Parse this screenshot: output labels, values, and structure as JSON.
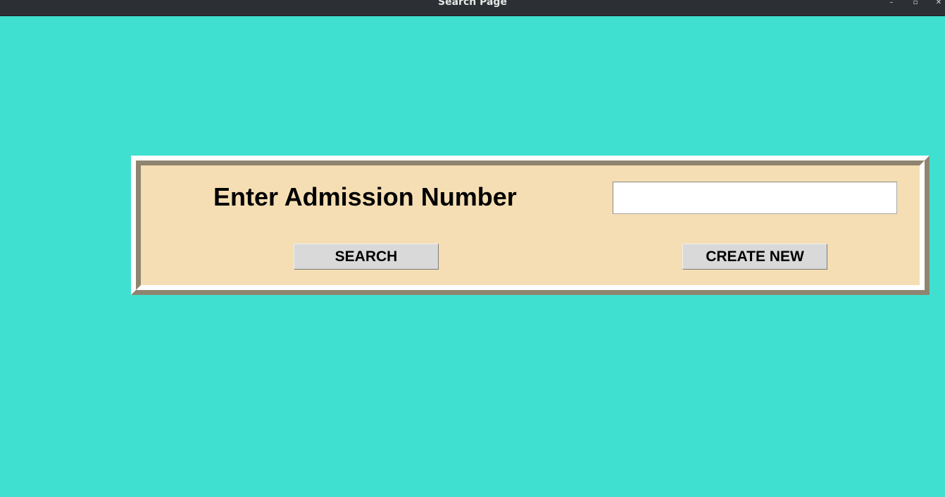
{
  "window": {
    "title": "Search Page",
    "controls": {
      "minimize": "–",
      "maximize": "▫",
      "close": "✕"
    }
  },
  "form": {
    "label": "Enter Admission Number",
    "admission_input": {
      "value": "",
      "placeholder": ""
    },
    "search_button": "SEARCH",
    "create_button": "CREATE NEW"
  },
  "colors": {
    "background": "#40e0d0",
    "panel": "#f5deb3",
    "frame_shadow": "#8f8470",
    "frame_highlight": "#ffffff",
    "button": "#d9d9d9",
    "titlebar": "#2c2f33"
  }
}
